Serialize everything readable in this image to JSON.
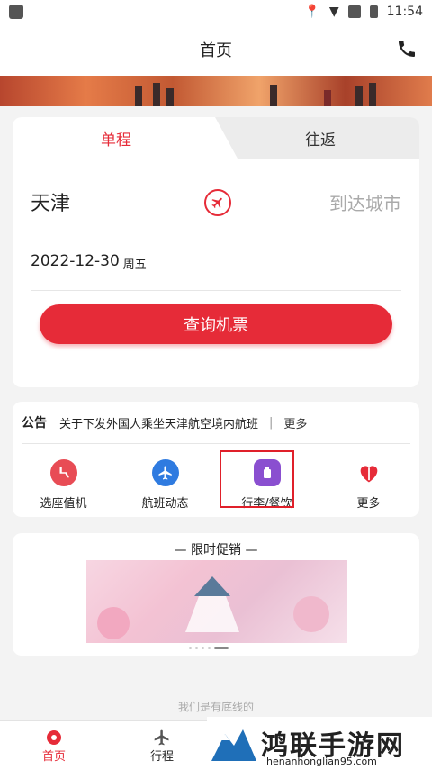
{
  "status": {
    "time": "11:54"
  },
  "header": {
    "title": "首页"
  },
  "search": {
    "tabs": [
      "单程",
      "往返"
    ],
    "from_city": "天津",
    "to_city_placeholder": "到达城市",
    "date": "2022-12-30",
    "weekday": "周五",
    "search_label": "查询机票"
  },
  "notice": {
    "tag": "公告",
    "text": "关于下发外国人乘坐天津航空境内航班",
    "more": "更多"
  },
  "quick_actions": [
    {
      "label": "选座值机",
      "icon": "seat-checkin-icon",
      "color": "#e84c55"
    },
    {
      "label": "航班动态",
      "icon": "flight-status-icon",
      "color": "#2f7be0"
    },
    {
      "label": "行李/餐饮",
      "icon": "luggage-meal-icon",
      "color": "#8a4fd0"
    },
    {
      "label": "更多",
      "icon": "heart-icon",
      "color": "#e62b38"
    }
  ],
  "promo": {
    "title": "— 限时促销 —"
  },
  "footer_hint": "我们是有底线的",
  "tabbar": [
    {
      "label": "首页"
    },
    {
      "label": "行程"
    }
  ],
  "watermark": {
    "title": "鸿联手游网",
    "url": "henanhonglian95.com"
  },
  "colors": {
    "accent": "#e62b38"
  }
}
